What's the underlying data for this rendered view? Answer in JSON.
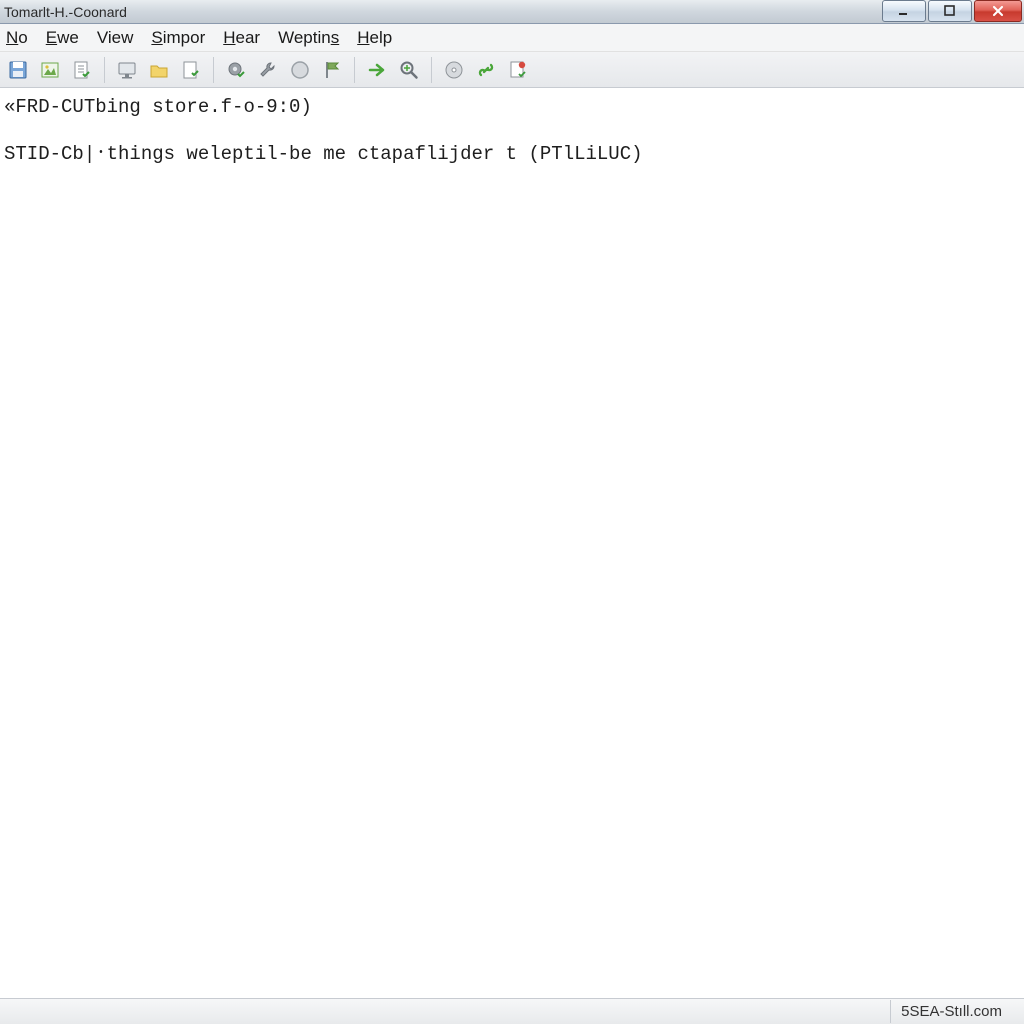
{
  "window": {
    "title": "Tomarlt-H.-Coonard"
  },
  "menubar": {
    "items": [
      {
        "label": "No",
        "accel_index": 0
      },
      {
        "label": "Ewe",
        "accel_index": 0
      },
      {
        "label": "View",
        "accel_index": -1
      },
      {
        "label": "Simpor",
        "accel_index": 0
      },
      {
        "label": "Hear",
        "accel_index": 0
      },
      {
        "label": "Weptins",
        "accel_index": 6
      },
      {
        "label": "Help",
        "accel_index": 0
      }
    ]
  },
  "toolbar": {
    "icons": [
      "save-icon",
      "picture-icon",
      "document-check-icon",
      "SEP",
      "monitor-icon",
      "folder-icon",
      "page-check-icon",
      "SEP",
      "gear-check-icon",
      "wrench-icon",
      "circle-icon",
      "flag-icon",
      "SEP",
      "arrow-right-icon",
      "magnifier-icon",
      "SEP",
      "disc-icon",
      "link-green-icon",
      "note-red-icon"
    ]
  },
  "content": {
    "line1": "«FRD-CUT​bing store.f-o-9:0)",
    "line2": "STID-Cb|᛫things weleptil-be me ctapaflijder t (PTlLiLUC)"
  },
  "statusbar": {
    "right": "5SEA-Stıll.com"
  },
  "colors": {
    "titlebar_close": "#d64a3f",
    "toolbar_green": "#5aa63a",
    "toolbar_yellow": "#dbbf3a",
    "toolbar_gray": "#8e9398"
  }
}
